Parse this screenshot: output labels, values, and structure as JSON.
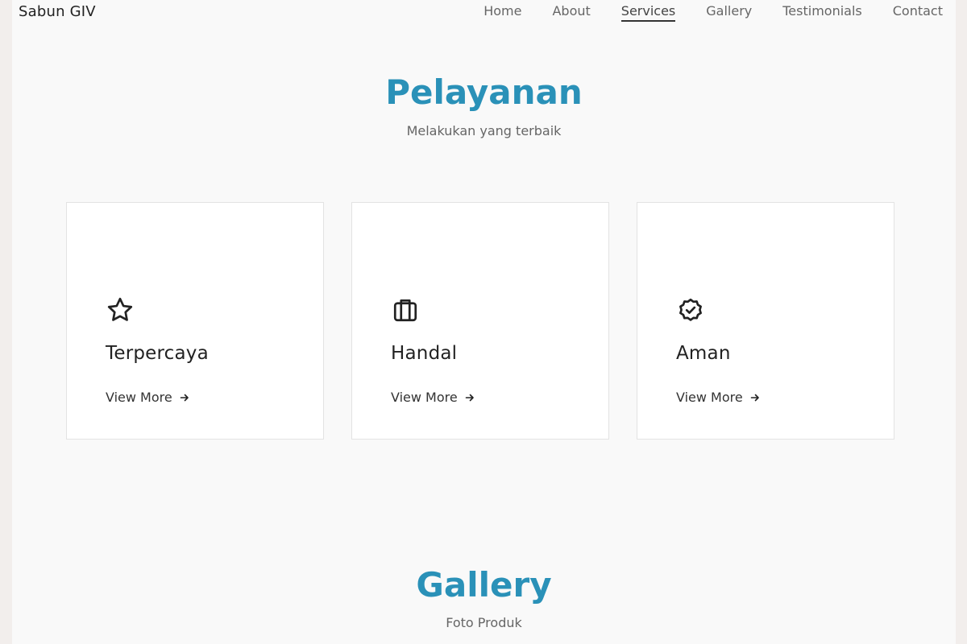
{
  "navbar": {
    "brand": "Sabun GIV",
    "links": [
      {
        "label": "Home",
        "active": false
      },
      {
        "label": "About",
        "active": false
      },
      {
        "label": "Services",
        "active": true
      },
      {
        "label": "Gallery",
        "active": false
      },
      {
        "label": "Testimonials",
        "active": false
      },
      {
        "label": "Contact",
        "active": false
      }
    ]
  },
  "services": {
    "title": "Pelayanan",
    "subtitle": "Melakukan yang terbaik",
    "cards": [
      {
        "icon": "star-icon",
        "title": "Terpercaya",
        "link_label": "View More"
      },
      {
        "icon": "briefcase-icon",
        "title": "Handal",
        "link_label": "View More"
      },
      {
        "icon": "badge-check-icon",
        "title": "Aman",
        "link_label": "View More"
      }
    ]
  },
  "gallery": {
    "title": "Gallery",
    "subtitle": "Foto Produk"
  },
  "colors": {
    "accent": "#2a91b8",
    "page_bg": "#f9f9f9",
    "outer_bg": "#f2eeec"
  }
}
